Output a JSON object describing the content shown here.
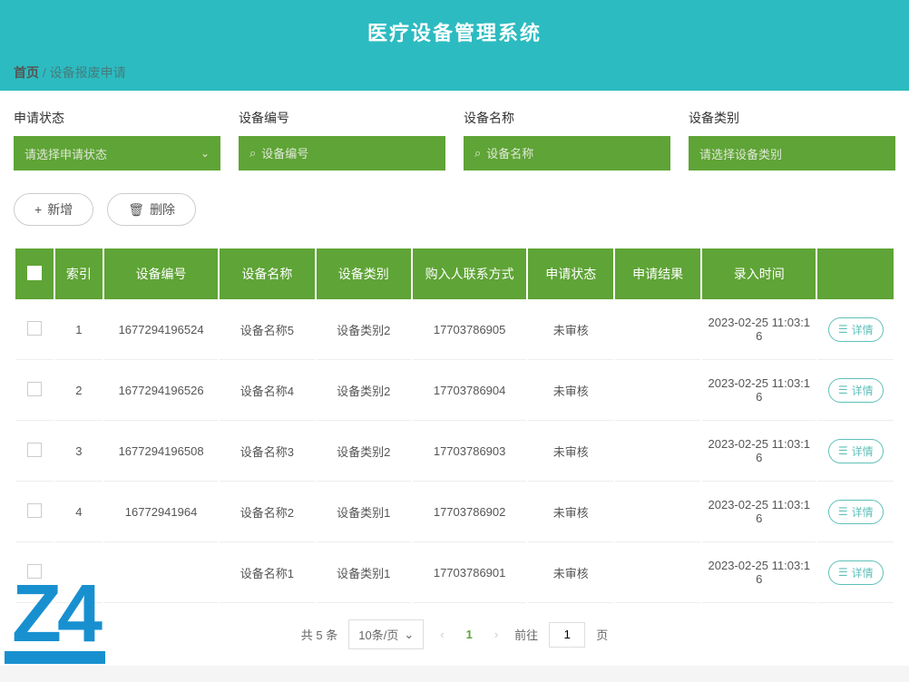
{
  "header": {
    "title": "医疗设备管理系统"
  },
  "breadcrumb": {
    "home": "首页",
    "sep": "/",
    "current": "设备报废申请"
  },
  "filters": {
    "status": {
      "label": "申请状态",
      "placeholder": "请选择申请状态"
    },
    "code": {
      "label": "设备编号",
      "placeholder": "设备编号"
    },
    "name": {
      "label": "设备名称",
      "placeholder": "设备名称"
    },
    "cat": {
      "label": "设备类别",
      "placeholder": "请选择设备类别"
    }
  },
  "actions": {
    "add": "新增",
    "del": "删除"
  },
  "table": {
    "headers": {
      "idx": "索引",
      "code": "设备编号",
      "name": "设备名称",
      "cat": "设备类别",
      "phone": "购入人联系方式",
      "status": "申请状态",
      "result": "申请结果",
      "time": "录入时间"
    },
    "detail_label": "详情",
    "rows": [
      {
        "idx": "1",
        "code": "1677294196524",
        "name": "设备名称5",
        "cat": "设备类别2",
        "phone": "17703786905",
        "status": "未审核",
        "result": "",
        "time": "2023-02-25 11:03:16"
      },
      {
        "idx": "2",
        "code": "1677294196526",
        "name": "设备名称4",
        "cat": "设备类别2",
        "phone": "17703786904",
        "status": "未审核",
        "result": "",
        "time": "2023-02-25 11:03:16"
      },
      {
        "idx": "3",
        "code": "1677294196508",
        "name": "设备名称3",
        "cat": "设备类别2",
        "phone": "17703786903",
        "status": "未审核",
        "result": "",
        "time": "2023-02-25 11:03:16"
      },
      {
        "idx": "4",
        "code": "16772941964",
        "name": "设备名称2",
        "cat": "设备类别1",
        "phone": "17703786902",
        "status": "未审核",
        "result": "",
        "time": "2023-02-25 11:03:16"
      },
      {
        "idx": "",
        "code": "",
        "name": "设备名称1",
        "cat": "设备类别1",
        "phone": "17703786901",
        "status": "未审核",
        "result": "",
        "time": "2023-02-25 11:03:16"
      }
    ]
  },
  "pagination": {
    "total_text": "共 5 条",
    "page_size": "10条/页",
    "current": "1",
    "jump_prefix": "前往",
    "jump_value": "1",
    "jump_suffix": "页"
  },
  "watermark": "Z4"
}
